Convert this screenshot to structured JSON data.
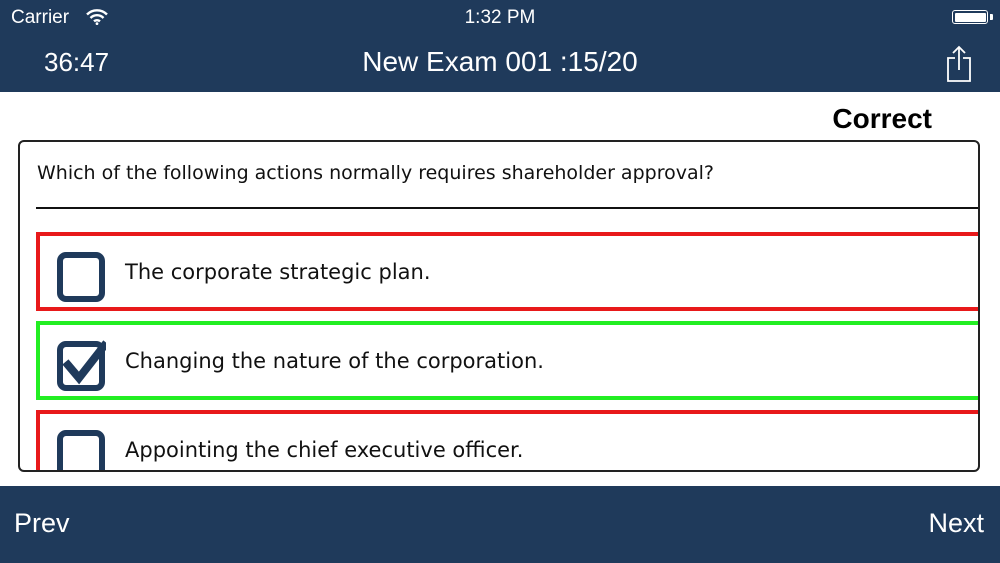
{
  "status_bar": {
    "carrier": "Carrier",
    "time": "1:32 PM"
  },
  "nav": {
    "timer": "36:47",
    "title": "New Exam 001 :15/20",
    "share_icon": "share-icon"
  },
  "result": "Correct",
  "question": {
    "text": "Which of the following actions normally requires shareholder approval?",
    "options": [
      {
        "label": "The corporate strategic plan.",
        "checked": false,
        "status": "wrong"
      },
      {
        "label": "Changing the nature of the corporation.",
        "checked": true,
        "status": "correct"
      },
      {
        "label": "Appointing the chief executive officer.",
        "checked": false,
        "status": "wrong"
      }
    ]
  },
  "toolbar": {
    "prev_label": "Prev",
    "next_label": "Next"
  },
  "colors": {
    "bar_background": "#1f3a5b",
    "wrong_border": "#e8191a",
    "correct_border": "#22ee22",
    "checkbox": "#1f3a5b"
  }
}
